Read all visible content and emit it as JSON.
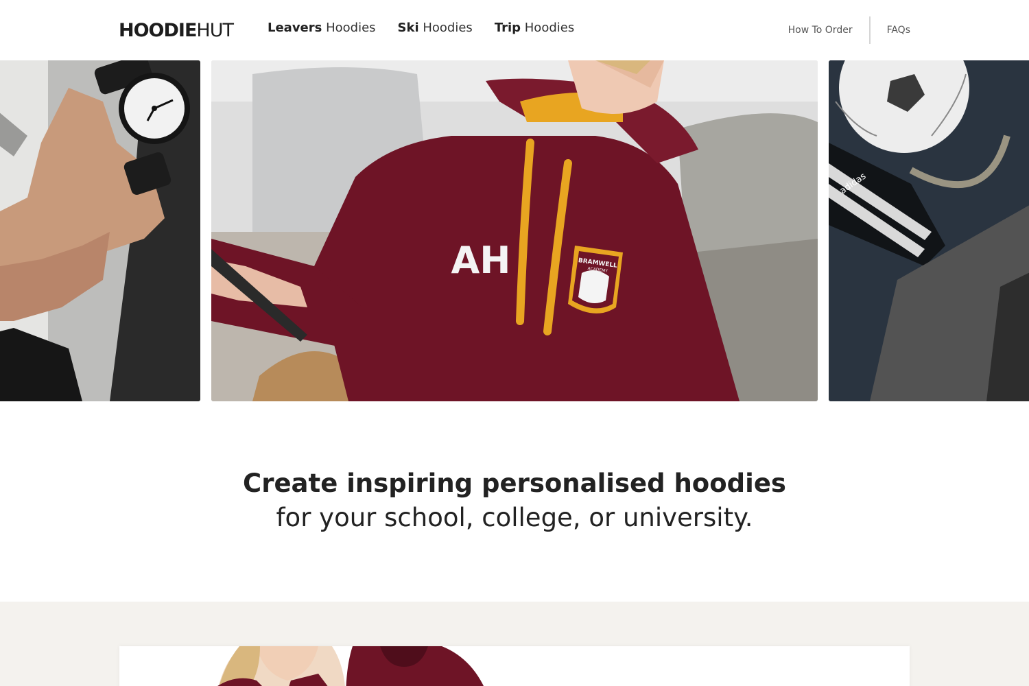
{
  "brand": {
    "logo_bold": "HOODIE",
    "logo_light": "HUT"
  },
  "nav": {
    "items": [
      {
        "bold": "Leavers",
        "rest": " Hoodies"
      },
      {
        "bold": "Ski",
        "rest": " Hoodies"
      },
      {
        "bold": "Trip",
        "rest": " Hoodies"
      }
    ]
  },
  "utility_nav": {
    "how_to_order": "How To Order",
    "faqs": "FAQs"
  },
  "hero": {
    "hoodie_initials": "AH",
    "crest_text": "BRAMWELL",
    "crest_subtext": "ACADEMY",
    "adidas_text": "adidas"
  },
  "tagline": {
    "prefix": "Create ",
    "emphasis": "inspiring personalised hoodies",
    "line2": "for your school, college, or university."
  },
  "colors": {
    "hoodie_maroon": "#6e1426",
    "drawstring_gold": "#e8a521",
    "band_bg": "#f4f2ee",
    "text_dark": "#222222"
  }
}
